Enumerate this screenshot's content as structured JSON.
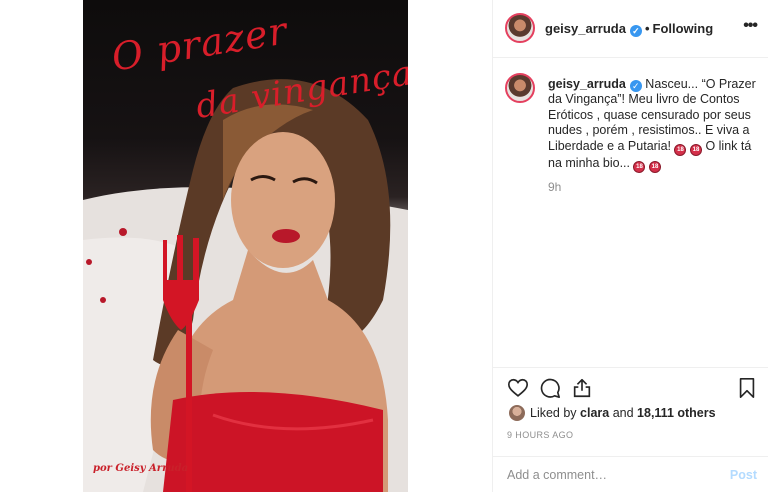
{
  "photo": {
    "title_line_1": "O prazer",
    "title_line_2": "da vingança",
    "credit": "por Geisy Arruda"
  },
  "header": {
    "username": "geisy_arruda",
    "verified_icon": "verified-badge-icon",
    "dot": "•",
    "follow_status": "Following",
    "more_icon": "more-options-icon"
  },
  "caption": {
    "username": "geisy_arruda",
    "text_part_1": " Nasceu... “O Prazer da Vingança”! Meu livro de Contos Eróticos , quase censurado por seus nudes , porém , resistimos.. E viva a Liberdade e a Putaria! ",
    "text_part_2": " O link tá na minha bio... ",
    "emoji_label": "18",
    "time": "9h"
  },
  "actions": {
    "like_icon": "heart-icon",
    "comment_icon": "comment-icon",
    "share_icon": "share-icon",
    "save_icon": "bookmark-icon"
  },
  "likes": {
    "prefix": "Liked by ",
    "user": "clara",
    "middle": " and ",
    "count": "18,111 others"
  },
  "post_time": "9 HOURS AGO",
  "comment": {
    "placeholder": "Add a comment…",
    "post_label": "Post"
  },
  "colors": {
    "accent_blue": "#3897f0",
    "post_disabled": "#b3dbff",
    "title_red": "#d81e2a"
  }
}
